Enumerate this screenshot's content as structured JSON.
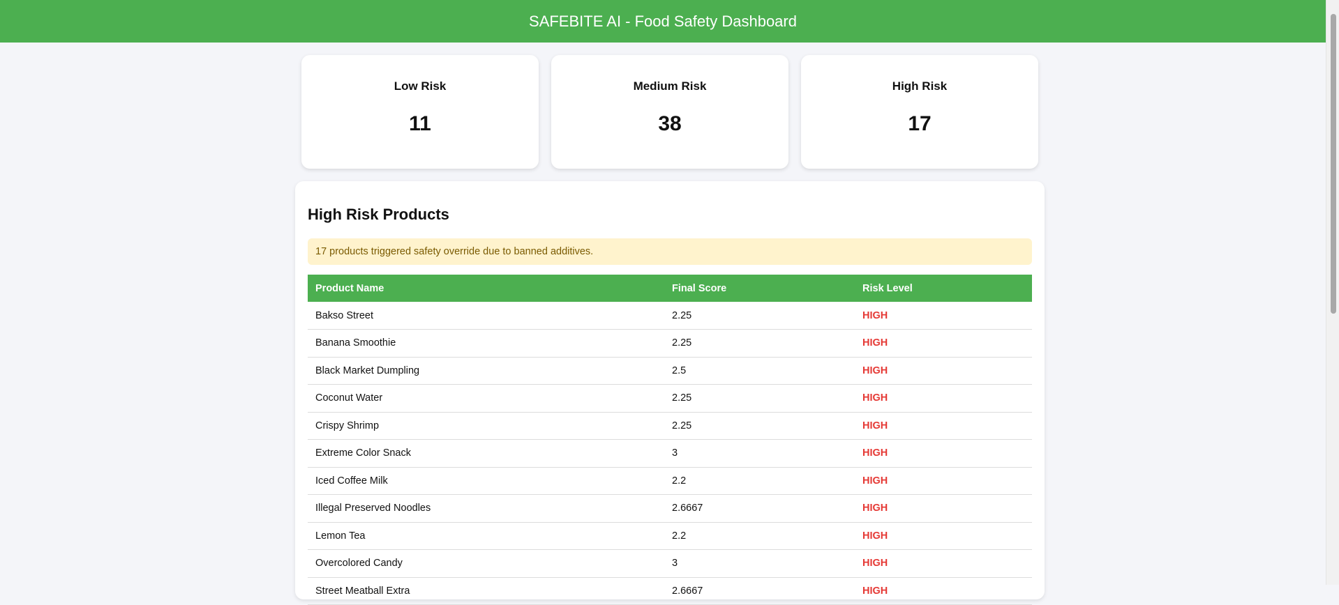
{
  "header": {
    "title": "SAFEBITE AI - Food Safety Dashboard"
  },
  "summary": [
    {
      "label": "Low Risk",
      "value": "11"
    },
    {
      "label": "Medium Risk",
      "value": "38"
    },
    {
      "label": "High Risk",
      "value": "17"
    }
  ],
  "panel": {
    "title": "High Risk Products",
    "alert": "17 products triggered safety override due to banned additives.",
    "columns": [
      "Product Name",
      "Final Score",
      "Risk Level"
    ],
    "rows": [
      {
        "name": "Bakso Street",
        "score": "2.25",
        "risk": "HIGH"
      },
      {
        "name": "Banana Smoothie",
        "score": "2.25",
        "risk": "HIGH"
      },
      {
        "name": "Black Market Dumpling",
        "score": "2.5",
        "risk": "HIGH"
      },
      {
        "name": "Coconut Water",
        "score": "2.25",
        "risk": "HIGH"
      },
      {
        "name": "Crispy Shrimp",
        "score": "2.25",
        "risk": "HIGH"
      },
      {
        "name": "Extreme Color Snack",
        "score": "3",
        "risk": "HIGH"
      },
      {
        "name": "Iced Coffee Milk",
        "score": "2.2",
        "risk": "HIGH"
      },
      {
        "name": "Illegal Preserved Noodles",
        "score": "2.6667",
        "risk": "HIGH"
      },
      {
        "name": "Lemon Tea",
        "score": "2.2",
        "risk": "HIGH"
      },
      {
        "name": "Overcolored Candy",
        "score": "3",
        "risk": "HIGH"
      },
      {
        "name": "Street Meatball Extra",
        "score": "2.6667",
        "risk": "HIGH"
      }
    ]
  },
  "colors": {
    "brand": "#4caf50",
    "high_risk": "#e53935",
    "alert_bg": "#fff3cd",
    "alert_text": "#7a5a00"
  }
}
